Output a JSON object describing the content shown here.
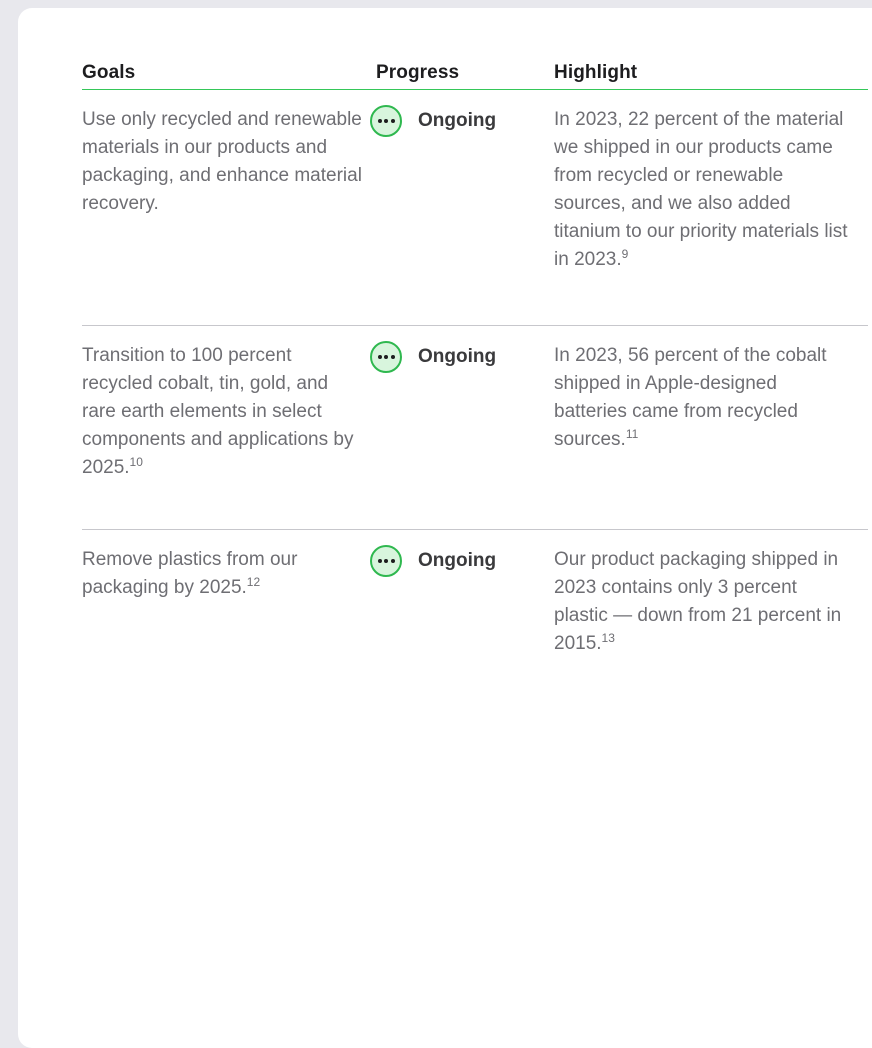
{
  "table": {
    "headers": {
      "goals": "Goals",
      "progress": "Progress",
      "highlight": "Highlight"
    },
    "rows": [
      {
        "goal": "Use only recycled and renewable materials in our products and packaging, and enhance material recovery.",
        "goal_footnote": "",
        "status": "Ongoing",
        "status_icon": "ellipsis-circle-icon",
        "highlight": "In 2023, 22 percent of the material we shipped in our products came from recycled or renewable sources, and we also added titanium to our priority materials list in 2023.",
        "highlight_footnote": "9"
      },
      {
        "goal": "Transition to 100 percent recycled cobalt, tin, gold, and rare earth elements in select components and applications by 2025.",
        "goal_footnote": "10",
        "status": "Ongoing",
        "status_icon": "ellipsis-circle-icon",
        "highlight": "In 2023, 56 percent of the cobalt shipped in Apple-designed batteries came from recycled sources.",
        "highlight_footnote": "11"
      },
      {
        "goal": "Remove plastics from our packaging by 2025.",
        "goal_footnote": "12",
        "status": "Ongoing",
        "status_icon": "ellipsis-circle-icon",
        "highlight": "Our product packaging shipped in 2023 contains only 3 percent plastic — down from 21 percent in 2015.",
        "highlight_footnote": "13"
      }
    ]
  },
  "colors": {
    "accent_green": "#35c759",
    "icon_fill": "#d8f5dd",
    "body_text": "#6e6e73",
    "heading_text": "#1d1d1f"
  }
}
